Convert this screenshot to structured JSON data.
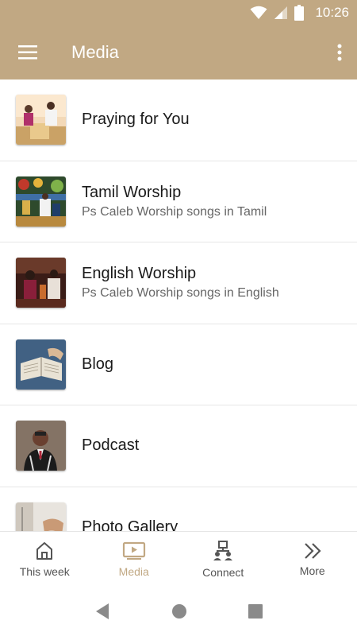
{
  "status_bar": {
    "time": "10:26",
    "icons": [
      "wifi-icon",
      "signal-icon",
      "battery-icon"
    ]
  },
  "app_bar": {
    "title": "Media",
    "menu_icon": "hamburger-menu-icon",
    "overflow_icon": "more-vert-icon"
  },
  "colors": {
    "primary": "#c1a883",
    "text": "#1a1a1a",
    "subtext": "#666666",
    "divider": "#e6e6e6"
  },
  "media_list": [
    {
      "title": "Praying for You",
      "subtitle": "",
      "thumb": "prayer-thumbnail"
    },
    {
      "title": "Tamil Worship",
      "subtitle": "Ps Caleb Worship songs in Tamil",
      "thumb": "tamil-worship-thumbnail"
    },
    {
      "title": "English Worship",
      "subtitle": "Ps Caleb Worship songs in English",
      "thumb": "english-worship-thumbnail"
    },
    {
      "title": "Blog",
      "subtitle": "",
      "thumb": "bible-thumbnail"
    },
    {
      "title": "Podcast",
      "subtitle": "",
      "thumb": "podcast-thumbnail"
    },
    {
      "title": "Photo Gallery",
      "subtitle": "",
      "thumb": "gallery-thumbnail"
    }
  ],
  "bottom_nav": [
    {
      "label": "This week",
      "icon": "home-icon",
      "active": false
    },
    {
      "label": "Media",
      "icon": "play-screen-icon",
      "active": true
    },
    {
      "label": "Connect",
      "icon": "connect-people-icon",
      "active": false
    },
    {
      "label": "More",
      "icon": "double-chevron-icon",
      "active": false
    }
  ],
  "system_nav": [
    "back-icon",
    "home-circle-icon",
    "recents-icon"
  ]
}
